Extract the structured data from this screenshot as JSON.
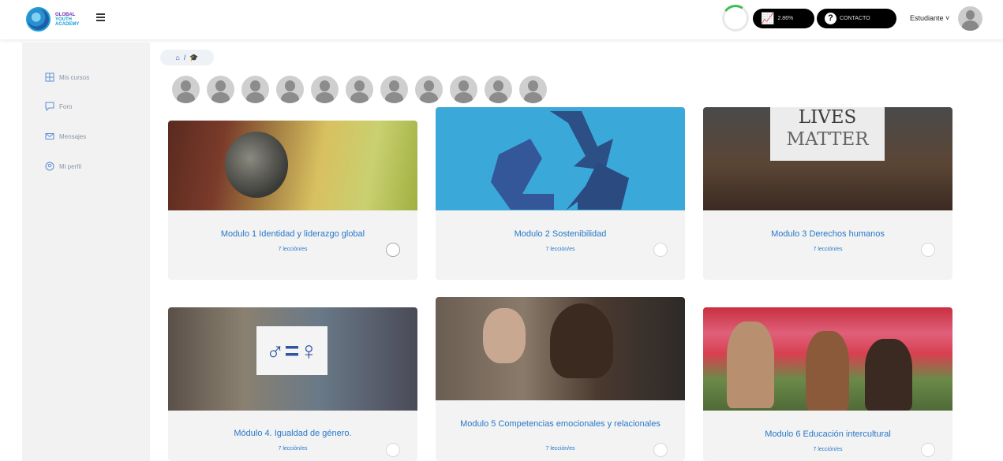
{
  "header": {
    "logo": {
      "line1": "GLOBAL",
      "line2": "YOUTH",
      "line3": "ACADEMY"
    },
    "stats_label": "2.86%",
    "contact_label": "CONTACTO",
    "user_label": "Estudiante ˅"
  },
  "sidebar": {
    "items": [
      {
        "label": "Mis cursos",
        "icon": "grid-icon"
      },
      {
        "label": "Foro",
        "icon": "chat-icon"
      },
      {
        "label": "Mensajes",
        "icon": "envelope-icon"
      },
      {
        "label": "Mi perfil",
        "icon": "user-circle-icon"
      }
    ]
  },
  "breadcrumb": {
    "home": "⌂",
    "sep": "/",
    "current": "🎓"
  },
  "participants_count": 11,
  "courses": [
    {
      "title": "Modulo 1 Identidad y liderazgo global",
      "lessons": "7 lección/es"
    },
    {
      "title": "Modulo 2 Sostenibilidad",
      "lessons": "7 lección/es"
    },
    {
      "title": "Modulo 3 Derechos humanos",
      "lessons": "7 lección/es"
    },
    {
      "title": "Módulo 4. Igualdad de género.",
      "lessons": "7 lección/es"
    },
    {
      "title": "Modulo 5 Competencias emocionales y relacionales",
      "lessons": "7 lección/es"
    },
    {
      "title": "Modulo 6 Educación intercultural",
      "lessons": "7 lección/es"
    }
  ],
  "course_images": {
    "c3_sign_line1": "LIVES",
    "c3_sign_line2": "MATTER",
    "c4_sign": "♂=♀"
  }
}
